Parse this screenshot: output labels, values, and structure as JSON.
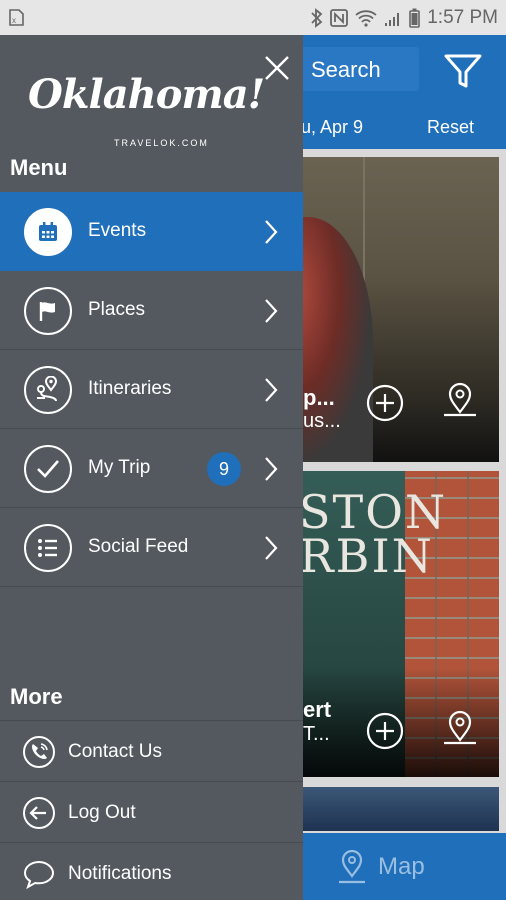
{
  "status_bar": {
    "time": "1:57 PM",
    "icons": [
      "sim-icon",
      "bluetooth-icon",
      "nfc-icon",
      "wifi-icon",
      "signal-icon",
      "battery-icon"
    ]
  },
  "background_app": {
    "search_label": "Search",
    "date_text": "u, Apr 9",
    "reset_label": "Reset",
    "cards": [
      {
        "title": "p...",
        "subtitle": "us..."
      },
      {
        "sign_line1": "STON",
        "sign_line2": "RBIN",
        "title": "ert",
        "subtitle": "T..."
      }
    ],
    "bottom_nav": {
      "map_label": "Map"
    }
  },
  "drawer": {
    "logo_text": "Oklahoma!",
    "logo_subtext": "TRAVELOK.COM",
    "menu_title": "Menu",
    "menu_items": [
      {
        "label": "Events",
        "icon": "calendar-icon",
        "active": true
      },
      {
        "label": "Places",
        "icon": "flag-icon",
        "active": false
      },
      {
        "label": "Itineraries",
        "icon": "route-icon",
        "active": false
      },
      {
        "label": "My Trip",
        "icon": "check-icon",
        "active": false,
        "badge": "9"
      },
      {
        "label": "Social Feed",
        "icon": "list-icon",
        "active": false
      }
    ],
    "more_title": "More",
    "more_items": [
      {
        "label": "Contact Us",
        "icon": "phone-icon"
      },
      {
        "label": "Log Out",
        "icon": "logout-icon"
      },
      {
        "label": "Notifications",
        "icon": "chat-icon"
      }
    ]
  },
  "colors": {
    "drawer_bg": "#53595e",
    "accent_blue": "#1f6fbb",
    "status_bar_bg": "#e6e6e6"
  }
}
